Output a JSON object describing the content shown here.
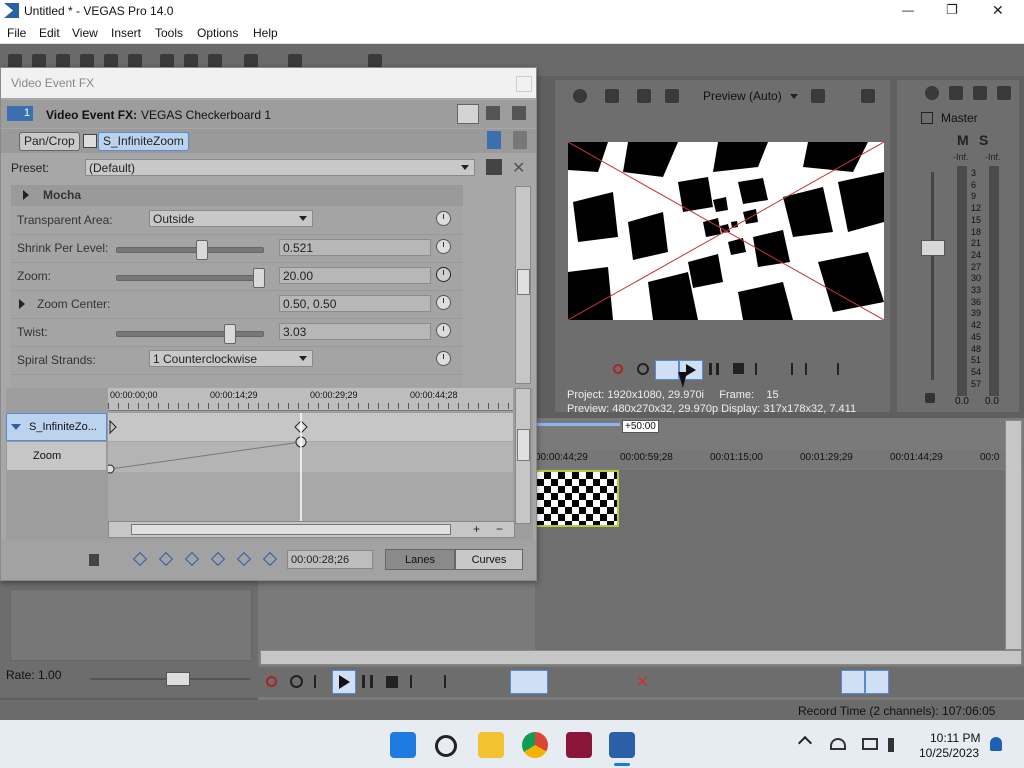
{
  "window": {
    "title": "Untitled * - VEGAS Pro 14.0",
    "controls": {
      "minimize": "—",
      "maximize": "❐",
      "close": "✕"
    }
  },
  "menu": [
    "File",
    "Edit",
    "View",
    "Insert",
    "Tools",
    "Options",
    "Help"
  ],
  "fx_window": {
    "title": "Video Event FX",
    "track_number": "1",
    "header_label": "Video Event FX:",
    "header_value": "VEGAS Checkerboard 1",
    "chain": [
      "Pan/Crop",
      "S_InfiniteZoom"
    ],
    "preset_label": "Preset:",
    "preset_value": "(Default)",
    "section": "Mocha",
    "params": [
      {
        "label": "Transparent Area:",
        "type": "combo",
        "value": "Outside"
      },
      {
        "label": "Shrink Per Level:",
        "type": "slider",
        "value": "0.521",
        "level": 0.58
      },
      {
        "label": "Zoom:",
        "type": "slider",
        "value": "20.00",
        "level": 1.0
      },
      {
        "label": "Zoom Center:",
        "type": "text",
        "value": "0.50, 0.50"
      },
      {
        "label": "Twist:",
        "type": "slider",
        "value": "3.03",
        "level": 0.79
      },
      {
        "label": "Spiral Strands:",
        "type": "combo",
        "value": "1 Counterclockwise"
      }
    ],
    "keyframes": {
      "ruler": [
        "00:00:00;00",
        "00:00:14;29",
        "00:00:29;29",
        "00:00:44;28"
      ],
      "track_name": "S_InfiniteZo...",
      "sub_track": "Zoom",
      "time_value": "00:00:28;26",
      "mode_buttons": [
        "Lanes",
        "Curves"
      ]
    }
  },
  "preview": {
    "quality": "Preview (Auto)",
    "project_label": "Project:",
    "project_value": "1920x1080, 29.970i",
    "frame_label": "Frame:",
    "frame_value": "15",
    "preview_label": "Preview:",
    "preview_value": "480x270x32, 29.970p",
    "display_label": "Display:",
    "display_value": "317x178x32, 7.411"
  },
  "mixer": {
    "title": "Master",
    "meter_labels": [
      "3",
      "6",
      "9",
      "12",
      "15",
      "18",
      "21",
      "24",
      "27",
      "30",
      "33",
      "36",
      "39",
      "42",
      "45",
      "48",
      "51",
      "54",
      "57"
    ],
    "inf_left": "-Inf.",
    "inf_right": "-Inf.",
    "level_left": "0.0",
    "level_right": "0.0"
  },
  "timeline": {
    "cursor_label": "+50:00",
    "ruler": [
      "00:00:44;29",
      "00:00:59;28",
      "00:01:15;00",
      "00:01:29;29",
      "00:01:44;29",
      "00:0"
    ],
    "rate": "Rate: 1.00",
    "record_time": "Record Time (2 channels): 107:06:05"
  },
  "taskbar": {
    "time": "10:11 PM",
    "date": "10/25/2023"
  },
  "colors": {
    "accent": "#4a78c6",
    "window_bg": "#a7a7a7",
    "panel": "#6e6e6e"
  }
}
